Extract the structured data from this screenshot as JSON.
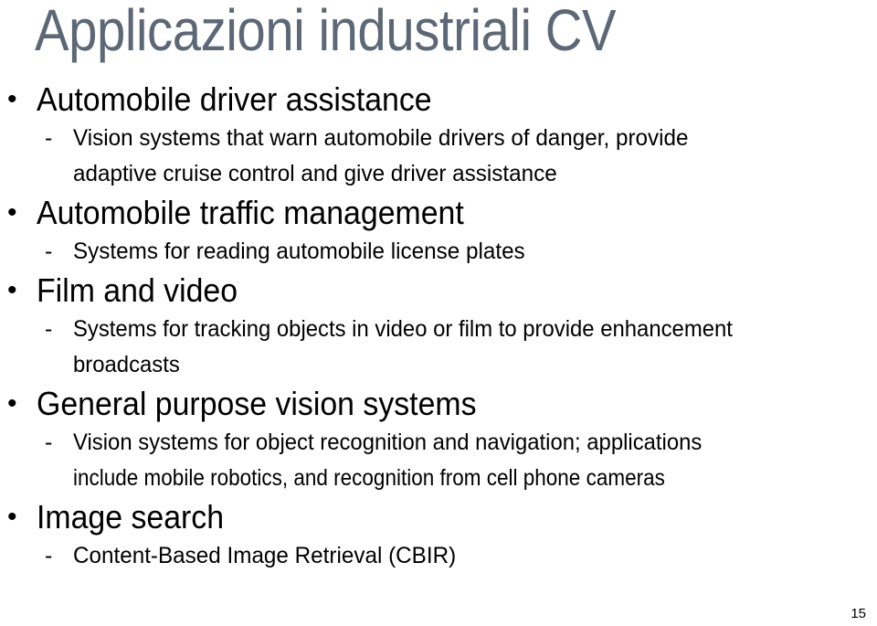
{
  "slide": {
    "title": "Applicazioni industriali CV",
    "title_color": "#5d6876",
    "body_color": "#000000",
    "background_color": "#ffffff",
    "page_number": "15",
    "bullet_marker": "•",
    "sub_bullet_marker": "-",
    "sections": [
      {
        "heading": "Automobile driver assistance",
        "sub": [
          {
            "lines": [
              "Vision systems that warn automobile drivers of danger, provide",
              "adaptive cruise control and give driver assistance"
            ]
          }
        ]
      },
      {
        "heading": "Automobile traffic management",
        "sub": [
          {
            "lines": [
              "Systems for reading automobile license plates"
            ]
          }
        ]
      },
      {
        "heading": "Film and video",
        "sub": [
          {
            "lines": [
              "Systems for tracking objects in video or film to provide enhancement",
              "broadcasts"
            ]
          }
        ]
      },
      {
        "heading": "General purpose vision systems",
        "sub": [
          {
            "lines": [
              "Vision systems for object recognition and navigation; applications",
              "include mobile robotics, and recognition from cell phone cameras"
            ]
          }
        ]
      },
      {
        "heading": "Image search",
        "sub": [
          {
            "lines": [
              "Content-Based Image Retrieval (CBIR)"
            ]
          }
        ]
      }
    ]
  }
}
